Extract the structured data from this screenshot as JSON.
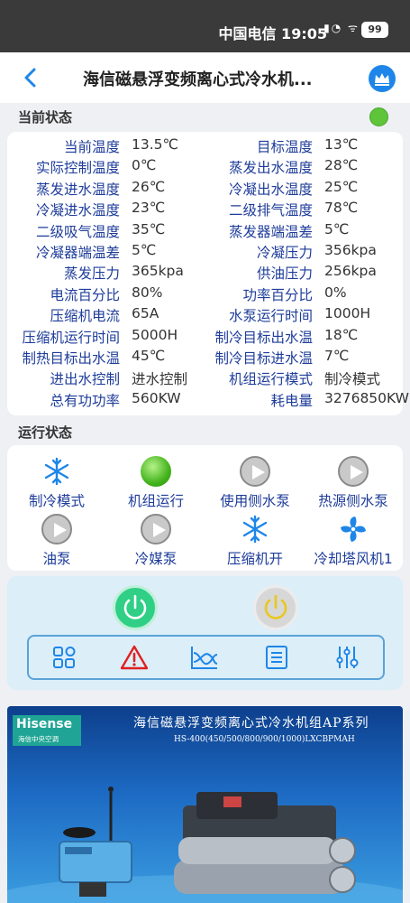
{
  "statusbar": {
    "text": "中国电信 19:05",
    "battery": "99"
  },
  "header": {
    "title": "海信磁悬浮变频离心式冷水机..."
  },
  "current_status": {
    "heading": "当前状态",
    "left": [
      {
        "k": "当前温度",
        "v": "13.5℃"
      },
      {
        "k": "实际控制温度",
        "v": "0℃"
      },
      {
        "k": "蒸发进水温度",
        "v": "26℃"
      },
      {
        "k": "冷凝进水温度",
        "v": "23℃"
      },
      {
        "k": "二级吸气温度",
        "v": "35℃"
      },
      {
        "k": "冷凝器端温差",
        "v": "5℃"
      },
      {
        "k": "蒸发压力",
        "v": "365kpa"
      },
      {
        "k": "电流百分比",
        "v": "80%"
      },
      {
        "k": "压缩机电流",
        "v": "65A"
      },
      {
        "k": "压缩机运行时间",
        "v": "5000H"
      },
      {
        "k": "制热目标出水温",
        "v": "45℃"
      },
      {
        "k": "进出水控制",
        "v": "进水控制"
      },
      {
        "k": "总有功功率",
        "v": "560KW"
      }
    ],
    "right": [
      {
        "k": "目标温度",
        "v": "13℃"
      },
      {
        "k": "蒸发出水温度",
        "v": "28℃"
      },
      {
        "k": "冷凝出水温度",
        "v": "25℃"
      },
      {
        "k": "二级排气温度",
        "v": "78℃"
      },
      {
        "k": "蒸发器端温差",
        "v": "5℃"
      },
      {
        "k": "冷凝压力",
        "v": "356kpa"
      },
      {
        "k": "供油压力",
        "v": "256kpa"
      },
      {
        "k": "功率百分比",
        "v": "0%"
      },
      {
        "k": "水泵运行时间",
        "v": "1000H"
      },
      {
        "k": "制冷目标出水温",
        "v": "18℃"
      },
      {
        "k": "制冷目标进水温",
        "v": "7℃"
      },
      {
        "k": "机组运行模式",
        "v": "制冷模式"
      },
      {
        "k": "耗电量",
        "v": "3276850KW"
      }
    ]
  },
  "run_status": {
    "heading": "运行状态",
    "items": [
      {
        "label": "制冷模式",
        "icon": "snowflake-icon"
      },
      {
        "label": "机组运行",
        "icon": "green-ball-icon"
      },
      {
        "label": "使用侧水泵",
        "icon": "play-gray-icon"
      },
      {
        "label": "热源侧水泵",
        "icon": "play-gray-icon"
      },
      {
        "label": "油泵",
        "icon": "play-gray-icon"
      },
      {
        "label": "冷媒泵",
        "icon": "play-gray-icon"
      },
      {
        "label": "压缩机开",
        "icon": "snowflake-icon"
      },
      {
        "label": "冷却塔风机1",
        "icon": "fan-icon"
      }
    ]
  },
  "controls": {
    "power_on": "power-on-button",
    "power_off": "power-off-button",
    "tools": [
      "grid-icon",
      "warning-icon",
      "chart-icon",
      "list-icon",
      "settings-sliders-icon"
    ]
  },
  "banner": {
    "brand": "Hisense",
    "brand_sub": "海信中央空调",
    "title": "海信磁悬浮变频离心式冷水机组AP系列",
    "model": "HS-400(450/500/800/900/1000)LXCBPMAH"
  },
  "colors": {
    "label": "#1e3c9a",
    "accent": "#1e86e8",
    "ok": "#5ec43a",
    "power_on": "#2fcf86"
  }
}
